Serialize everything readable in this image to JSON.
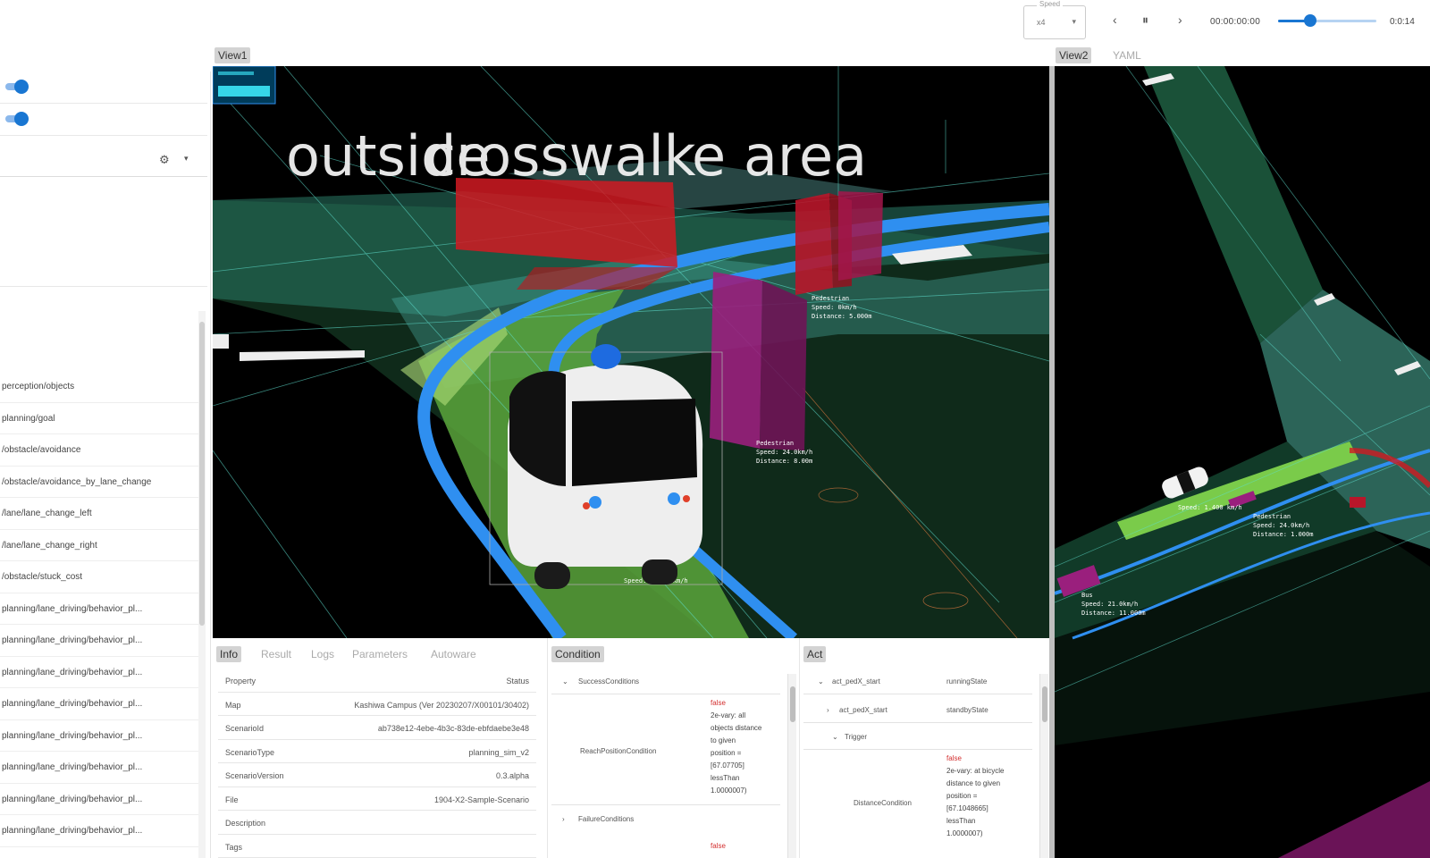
{
  "toolbar": {
    "speed_legend": "Speed",
    "speed_value": "x4",
    "speed_arrow": "▾",
    "prev_label": "‹",
    "pause_label": "⏸",
    "next_label": "›",
    "current_time": "00:00:00:00",
    "total_time": "0:0:14",
    "progress": 0.33
  },
  "left": {
    "layer_gear": "⚙",
    "layer_chevron": "▾",
    "topics": [
      "perception/objects",
      "planning/goal",
      "/obstacle/avoidance",
      "/obstacle/avoidance_by_lane_change",
      "/lane/lane_change_left",
      "/lane/lane_change_right",
      "/obstacle/stuck_cost",
      "planning/lane_driving/behavior_pl...",
      "planning/lane_driving/behavior_pl...",
      "planning/lane_driving/behavior_pl...",
      "planning/lane_driving/behavior_pl...",
      "planning/lane_driving/behavior_pl...",
      "planning/lane_driving/behavior_pl...",
      "planning/lane_driving/behavior_pl...",
      "planning/lane_driving/behavior_pl..."
    ]
  },
  "view1": {
    "label": "View1",
    "overlay_text_1": "outside",
    "overlay_text_2": "crosswalk",
    "overlay_text_3": "e area",
    "npc_top_labels": [
      "Pedestrian",
      "Speed: 0km/h",
      "Distance: 5.000m"
    ],
    "npc_mid_labels": [
      "Pedestrian",
      "Speed: 24.0km/h",
      "Distance: 8.00m"
    ],
    "ego_label": "Speed: 0.400 km/h"
  },
  "view2": {
    "label": "View2",
    "tab2_label": "YAML",
    "ego_label": "Speed: 1.400 km/h",
    "npc1_labels": [
      "Pedestrian",
      "Speed: 24.0km/h",
      "Distance: 1.000m"
    ],
    "npc2_labels": [
      "Bus",
      "Speed: 21.0km/h",
      "Distance: 11.000m"
    ]
  },
  "info": {
    "tabs": [
      "Info",
      "Result",
      "Logs",
      "Parameters",
      "Autoware"
    ],
    "rows": [
      {
        "k": "Property",
        "v": "Status"
      },
      {
        "k": "Map",
        "v": "Kashiwa Campus (Ver 20230207/X00101/30402)"
      },
      {
        "k": "ScenarioId",
        "v": "ab738e12-4ebe-4b3c-83de-ebfdaebe3e48"
      },
      {
        "k": "ScenarioType",
        "v": "planning_sim_v2"
      },
      {
        "k": "ScenarioVersion",
        "v": "0.3.alpha"
      },
      {
        "k": "File",
        "v": "1904-X2-Sample-Scenario"
      },
      {
        "k": "Description",
        "v": ""
      },
      {
        "k": "Tags",
        "v": ""
      }
    ]
  },
  "condition": {
    "label": "Condition",
    "success_label": "SuccessConditions",
    "reach_label": "ReachPositionCondition",
    "false_label": "false",
    "reach_text": "2e-vary: all\nobjects distance\nto given\nposition =\n[67.07705]\nlessThan\n1.0000007)",
    "failure_label": "FailureConditions",
    "false_label_2": "false"
  },
  "act": {
    "label": "Act",
    "row1_key": "act_pedX_start",
    "row1_val": "runningState",
    "row2_key": "act_pedX_start",
    "row2_val": "standbyState",
    "trigger_label": "Trigger",
    "distance_label": "DistanceCondition",
    "false_label": "false",
    "distance_text": "2e-vary: at bicycle\ndistance to given\nposition =\n[67.1048665]\nlessThan\n1.0000007)"
  },
  "colors": {
    "accent": "#1976d2",
    "npc_red": "#d11a22",
    "npc_purple": "#8e1d6f",
    "lane_blue": "#2f8ff0",
    "road_green": "#4caf50"
  }
}
